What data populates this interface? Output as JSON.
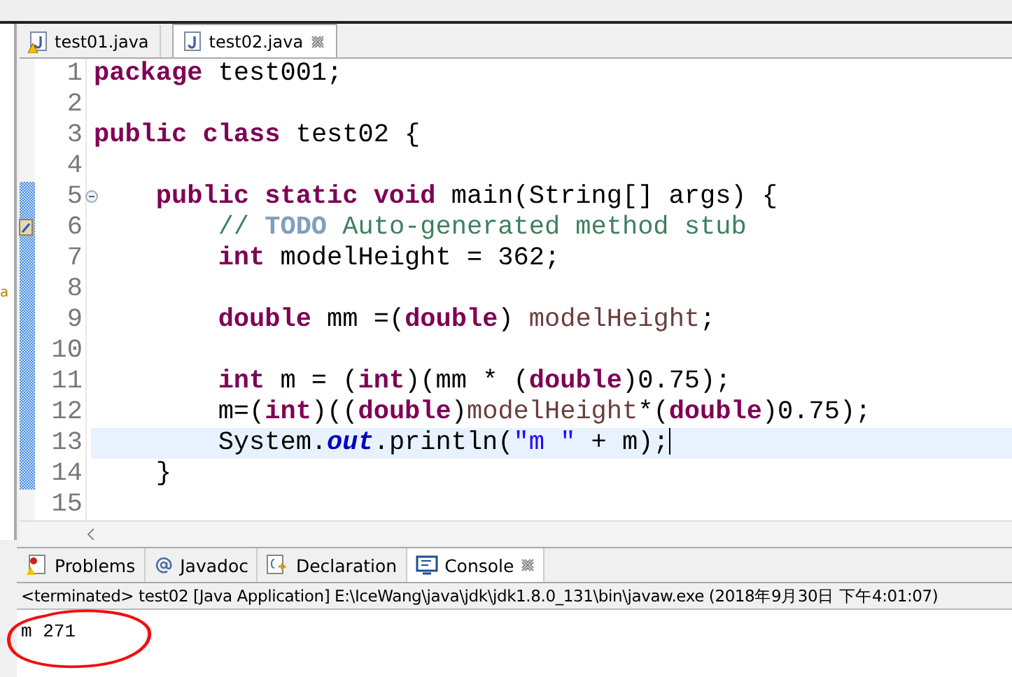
{
  "left_panel": {
    "fragment": "a"
  },
  "editor_tabs": [
    {
      "label": "test01.java",
      "selected": false,
      "warning": true
    },
    {
      "label": "test02.java",
      "selected": true,
      "warning": false
    }
  ],
  "code_lines": [
    {
      "number": "1",
      "current": false,
      "foldable": false,
      "task": false,
      "tokens": [
        {
          "kind": "keyword",
          "text": "package"
        },
        {
          "kind": "plain",
          "text": " test001;"
        }
      ]
    },
    {
      "number": "2",
      "current": false,
      "foldable": false,
      "task": false
    },
    {
      "number": "3",
      "current": false,
      "foldable": false,
      "task": false,
      "tokens": [
        {
          "kind": "keyword",
          "text": "public class"
        },
        {
          "kind": "plain",
          "text": " test02 {"
        }
      ]
    },
    {
      "number": "4",
      "current": false,
      "foldable": false,
      "task": false
    },
    {
      "number": "5",
      "current": false,
      "foldable": true,
      "task": false,
      "tokens": [
        {
          "kind": "keyword",
          "text": "    public static void"
        },
        {
          "kind": "plain",
          "text": " main(String[] args) {"
        }
      ]
    },
    {
      "number": "6",
      "current": false,
      "foldable": false,
      "task": true,
      "tokens": [
        {
          "kind": "comment",
          "text": "        // "
        },
        {
          "kind": "todo",
          "text": "TODO"
        },
        {
          "kind": "comment",
          "text": " Auto-generated method stub"
        }
      ]
    },
    {
      "number": "7",
      "current": false,
      "foldable": false,
      "task": false,
      "tokens": [
        {
          "kind": "keyword",
          "text": "        int"
        },
        {
          "kind": "plain",
          "text": " modelHeight = 362;"
        }
      ]
    },
    {
      "number": "8",
      "current": false,
      "foldable": false,
      "task": false
    },
    {
      "number": "9",
      "current": false,
      "foldable": false,
      "task": false,
      "tokens": [
        {
          "kind": "keyword",
          "text": "        double"
        },
        {
          "kind": "plain",
          "text": " mm =("
        },
        {
          "kind": "keyword",
          "text": "double"
        },
        {
          "kind": "plain",
          "text": ") "
        },
        {
          "kind": "variable",
          "text": "modelHeight"
        },
        {
          "kind": "plain",
          "text": ";"
        }
      ]
    },
    {
      "number": "10",
      "current": false,
      "foldable": false,
      "task": false
    },
    {
      "number": "11",
      "current": false,
      "foldable": false,
      "task": false,
      "tokens": [
        {
          "kind": "keyword",
          "text": "        int"
        },
        {
          "kind": "plain",
          "text": " m = ("
        },
        {
          "kind": "keyword",
          "text": "int"
        },
        {
          "kind": "plain",
          "text": ")(mm * ("
        },
        {
          "kind": "keyword",
          "text": "double"
        },
        {
          "kind": "plain",
          "text": ")0.75);"
        }
      ]
    },
    {
      "number": "12",
      "current": false,
      "foldable": false,
      "task": false,
      "tokens": [
        {
          "kind": "plain",
          "text": "        m=("
        },
        {
          "kind": "keyword",
          "text": "int"
        },
        {
          "kind": "plain",
          "text": ")(("
        },
        {
          "kind": "keyword",
          "text": "double"
        },
        {
          "kind": "plain",
          "text": ")"
        },
        {
          "kind": "variable",
          "text": "modelHeight"
        },
        {
          "kind": "plain",
          "text": "*("
        },
        {
          "kind": "keyword",
          "text": "double"
        },
        {
          "kind": "plain",
          "text": ")0.75);"
        }
      ]
    },
    {
      "number": "13",
      "current": true,
      "foldable": false,
      "task": false,
      "tokens": [
        {
          "kind": "plain",
          "text": "        System."
        },
        {
          "kind": "field",
          "text": "out"
        },
        {
          "kind": "plain",
          "text": ".println("
        },
        {
          "kind": "string",
          "text": "\"m \""
        },
        {
          "kind": "plain",
          "text": " + m);"
        }
      ]
    },
    {
      "number": "14",
      "current": false,
      "foldable": false,
      "task": false,
      "tokens": [
        {
          "kind": "plain",
          "text": "    }"
        }
      ]
    },
    {
      "number": "15",
      "current": false,
      "foldable": false,
      "task": false
    }
  ],
  "view_tabs": [
    {
      "label": "Problems",
      "selected": false
    },
    {
      "label": "Javadoc",
      "selected": false
    },
    {
      "label": "Declaration",
      "selected": false
    },
    {
      "label": "Console",
      "selected": true
    }
  ],
  "console": {
    "header": "<terminated> test02 [Java Application] E:\\IceWang\\java\\jdk\\jdk1.8.0_131\\bin\\javaw.exe (2018年9月30日 下午4:01:07)",
    "output": "m 271"
  }
}
